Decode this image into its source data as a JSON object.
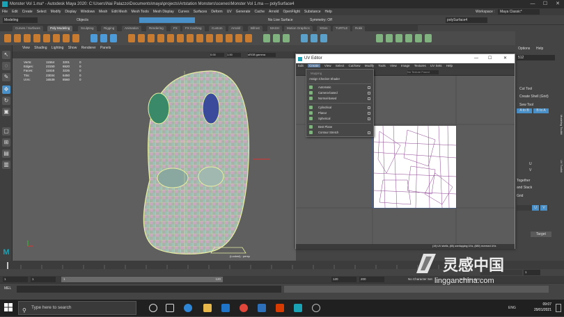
{
  "window": {
    "title": "Monster Vol 1.ma* - Autodesk Maya 2020: C:\\Users\\Nai Palazzo\\Documents\\maya\\projects\\Artstation Monsters\\scenes\\Monster Vol 1.ma   ---   polySurface4",
    "minimize": "—",
    "maximize": "☐",
    "close": "✕"
  },
  "main_menu": [
    "File",
    "Edit",
    "Create",
    "Select",
    "Modify",
    "Display",
    "Windows",
    "Mesh",
    "Edit Mesh",
    "Mesh Tools",
    "Mesh Display",
    "Curves",
    "Surfaces",
    "Deform",
    "UV",
    "Generate",
    "Cache",
    "Arnold",
    "OpenFlight",
    "Substance",
    "Help"
  ],
  "workspace": {
    "label": "Workspace :",
    "value": "Maya Classic*"
  },
  "status_line": {
    "mode": "Modeling",
    "objects": "Objects",
    "live_surface": "No Live Surface",
    "symmetry": "Symmetry: Off",
    "object_name": "polySurface4"
  },
  "shelf_tabs": [
    "Curves / Surfaces",
    "Poly Modeling",
    "Sculpting",
    "Rigging",
    "Animation",
    "Rendering",
    "FX",
    "FX Caching",
    "Custom",
    "Arnold",
    "Bifrost",
    "MASH",
    "Motion Graphics",
    "XGen",
    "TURTLE",
    "Rokk"
  ],
  "shelf_active": "Poly Modeling",
  "panel_menu": [
    "View",
    "Shading",
    "Lighting",
    "Show",
    "Renderer",
    "Panels"
  ],
  "panel_toolbar": {
    "field1": "0.00",
    "field2": "1.00",
    "colorspace": "sRGB gamma"
  },
  "hud": [
    {
      "label": "Verts:",
      "a": "11564",
      "b": "3201",
      "c": "0"
    },
    {
      "label": "Edges:",
      "a": "23150",
      "b": "6520",
      "c": "0"
    },
    {
      "label": "Faces:",
      "a": "11616",
      "b": "3226",
      "c": "0"
    },
    {
      "label": "Tris:",
      "a": "23034",
      "b": "6450",
      "c": "0"
    },
    {
      "label": "UVs:",
      "a": "16539",
      "b": "8560",
      "c": "0"
    }
  ],
  "camera_label": "(Locked) : persp",
  "uv_editor": {
    "title": "UV Editor",
    "menu": [
      "Edit",
      "Create",
      "View",
      "Select",
      "Cut/Sew",
      "Modify",
      "Tools",
      "View",
      "Image",
      "Textures",
      "UV Sets",
      "Help"
    ],
    "active_menu": "Create",
    "toolbar_text": "No Texture Found",
    "status_text": "(19) UV shells, (85) overlapping UVs, (889) reversed UVs",
    "create_menu": [
      {
        "label": "Mapping",
        "type": "header"
      },
      {
        "label": "Assign Checker Shader",
        "type": "item"
      },
      {
        "label": "Automatic",
        "type": "item",
        "box": true
      },
      {
        "label": "Camera-based",
        "type": "item",
        "box": true
      },
      {
        "label": "Normal-based",
        "type": "item",
        "box": true
      },
      {
        "label": "Cylindrical",
        "type": "item",
        "box": true
      },
      {
        "label": "Planar",
        "type": "item",
        "box": true
      },
      {
        "label": "Spherical",
        "type": "item",
        "box": true
      },
      {
        "label": "Best Plane",
        "type": "item"
      },
      {
        "label": "Contour Stretch",
        "type": "item",
        "box": true
      }
    ]
  },
  "right_panel": {
    "top_menu": [
      "Options",
      "Help"
    ],
    "field": "512",
    "cut_tool": "Cut Tool",
    "create_shell": "Create Shell (Grid)",
    "sew_tool": "Sew Tool",
    "btn_a": "A to B",
    "btn_b": "B to A",
    "together": "Together",
    "stack": "and Stack",
    "grid": "Grid",
    "target": "Target",
    "u_label": "U",
    "v_label": "V",
    "side_tabs": [
      "Modeling Toolkit",
      "Attribute Editor",
      "UV Toolkit"
    ]
  },
  "timeline": {
    "ticks": [
      "5",
      "10",
      "15",
      "20",
      "25",
      "30",
      "35",
      "40",
      "45",
      "50",
      "55",
      "60",
      "65",
      "70",
      "75",
      "80",
      "85",
      "90",
      "95",
      "100",
      "105",
      "110",
      "115",
      "120"
    ],
    "current_frame": "1"
  },
  "range_slider": {
    "start": "1",
    "inner_start": "1",
    "inner_end": "120",
    "end": "120",
    "outer_end": "200",
    "character_set": "No Character Set",
    "anim_layer": "No Anim Layer"
  },
  "command_line": {
    "label": "MEL"
  },
  "taskbar": {
    "search_placeholder": "Type here to search",
    "lang": "ENG",
    "time": "09:07",
    "date": "29/01/2021"
  },
  "watermark": {
    "cn": "灵感中国",
    "url": "lingganchina.com"
  },
  "colors": {
    "maya_blue": "#19a3b5",
    "selection_blue": "#4a90c8",
    "shelf_orange": "#c77b30",
    "uv_purple": "#8a3f8f"
  }
}
